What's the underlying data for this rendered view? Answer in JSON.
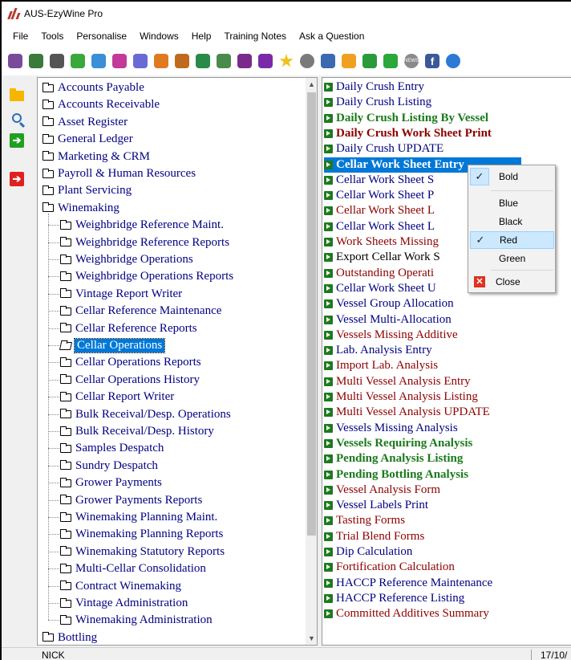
{
  "window": {
    "title": "AUS-EzyWine Pro"
  },
  "menubar": [
    "File",
    "Tools",
    "Personalise",
    "Windows",
    "Help",
    "Training Notes",
    "Ask a Question"
  ],
  "toolbar": {
    "icons": [
      {
        "name": "grapes-icon",
        "color": "#7a4a9a"
      },
      {
        "name": "pencil-icon",
        "color": "#3a7a3a"
      },
      {
        "name": "bank-icon",
        "color": "#555555"
      },
      {
        "name": "money-icon",
        "color": "#3aa83a"
      },
      {
        "name": "window-icon",
        "color": "#3a8fd6"
      },
      {
        "name": "people-icon",
        "color": "#c23a9a"
      },
      {
        "name": "wand-icon",
        "color": "#6a6ad6"
      },
      {
        "name": "barrel-icon",
        "color": "#e07a20"
      },
      {
        "name": "box-icon",
        "color": "#c06a20"
      },
      {
        "name": "bottles-icon",
        "color": "#2a8a4a"
      },
      {
        "name": "person-icon",
        "color": "#4a8a4a"
      },
      {
        "name": "glass-icon",
        "color": "#7a2a8a"
      },
      {
        "name": "grape-bunch-icon",
        "color": "#7a2aa8"
      },
      {
        "name": "star-icon",
        "color": "#f0c020"
      },
      {
        "name": "gear-icon",
        "color": "#7a7a7a"
      },
      {
        "name": "screen-icon",
        "color": "#3a6ab0"
      },
      {
        "name": "package-icon",
        "color": "#f0a020"
      },
      {
        "name": "plant-icon",
        "color": "#2a9a3a"
      },
      {
        "name": "dollar-icon",
        "color": "#2aa83a"
      },
      {
        "name": "news-icon",
        "color": "#8a8a8a"
      },
      {
        "name": "facebook-icon",
        "color": "#3b5998"
      },
      {
        "name": "globe-icon",
        "color": "#2a7ad6"
      }
    ],
    "news_label": "NEWS",
    "facebook_label": "f"
  },
  "tree": {
    "items": [
      {
        "label": "Accounts Payable",
        "level": 0
      },
      {
        "label": "Accounts Receivable",
        "level": 0
      },
      {
        "label": "Asset Register",
        "level": 0
      },
      {
        "label": "General Ledger",
        "level": 0
      },
      {
        "label": "Marketing & CRM",
        "level": 0
      },
      {
        "label": "Payroll & Human Resources",
        "level": 0
      },
      {
        "label": "Plant Servicing",
        "level": 0
      },
      {
        "label": "Winemaking",
        "level": 0
      },
      {
        "label": "Weighbridge Reference Maint.",
        "level": 1
      },
      {
        "label": "Weighbridge Reference Reports",
        "level": 1
      },
      {
        "label": "Weighbridge Operations",
        "level": 1
      },
      {
        "label": "Weighbridge Operations Reports",
        "level": 1
      },
      {
        "label": "Vintage Report Writer",
        "level": 1
      },
      {
        "label": "Cellar Reference Maintenance",
        "level": 1
      },
      {
        "label": "Cellar Reference Reports",
        "level": 1
      },
      {
        "label": "Cellar Operations",
        "level": 1,
        "selected": true
      },
      {
        "label": "Cellar Operations Reports",
        "level": 1
      },
      {
        "label": "Cellar Operations History",
        "level": 1
      },
      {
        "label": "Cellar Report Writer",
        "level": 1
      },
      {
        "label": "Bulk Receival/Desp. Operations",
        "level": 1
      },
      {
        "label": "Bulk Receival/Desp. History",
        "level": 1
      },
      {
        "label": "Samples Despatch",
        "level": 1
      },
      {
        "label": "Sundry Despatch",
        "level": 1
      },
      {
        "label": "Grower Payments",
        "level": 1
      },
      {
        "label": "Grower Payments Reports",
        "level": 1
      },
      {
        "label": "Winemaking Planning Maint.",
        "level": 1
      },
      {
        "label": "Winemaking Planning Reports",
        "level": 1
      },
      {
        "label": "Winemaking Statutory Reports",
        "level": 1
      },
      {
        "label": "Multi-Cellar Consolidation",
        "level": 1
      },
      {
        "label": "Contract Winemaking",
        "level": 1
      },
      {
        "label": "Vintage Administration",
        "level": 1
      },
      {
        "label": "Winemaking Administration",
        "level": 1
      },
      {
        "label": "Bottling",
        "level": 0
      }
    ]
  },
  "operations": {
    "items": [
      {
        "label": "Daily Crush Entry",
        "color": "#000080",
        "bold": false
      },
      {
        "label": "Daily Crush Listing",
        "color": "#000080",
        "bold": false
      },
      {
        "label": "Daily Crush Listing By Vessel",
        "color": "#1a7a1a",
        "bold": true
      },
      {
        "label": "Daily Crush Work Sheet Print",
        "color": "#8b0000",
        "bold": true
      },
      {
        "label": "Daily Crush UPDATE",
        "color": "#000080",
        "bold": false
      },
      {
        "label": "Cellar Work Sheet Entry",
        "color": "#ffffff",
        "bold": true,
        "selected": true
      },
      {
        "label": "Cellar Work Sheet S",
        "color": "#000080",
        "bold": false
      },
      {
        "label": "Cellar Work Sheet P",
        "color": "#000080",
        "bold": false
      },
      {
        "label": "Cellar Work Sheet L",
        "color": "#8b0000",
        "bold": false
      },
      {
        "label": "Cellar Work Sheet L",
        "color": "#000080",
        "bold": false
      },
      {
        "label": "Work Sheets Missing",
        "color": "#8b0000",
        "bold": false
      },
      {
        "label": "Export Cellar Work S",
        "color": "#000000",
        "bold": false
      },
      {
        "label": "Outstanding Operati",
        "color": "#8b0000",
        "bold": false
      },
      {
        "label": "Cellar Work Sheet U",
        "color": "#000080",
        "bold": false
      },
      {
        "label": "Vessel Group Allocation",
        "color": "#000080",
        "bold": false
      },
      {
        "label": "Vessel Multi-Allocation",
        "color": "#000080",
        "bold": false
      },
      {
        "label": "Vessels Missing Additive",
        "color": "#8b0000",
        "bold": false
      },
      {
        "label": "Lab. Analysis Entry",
        "color": "#000080",
        "bold": false
      },
      {
        "label": "Import Lab. Analysis",
        "color": "#8b0000",
        "bold": false
      },
      {
        "label": "Multi Vessel Analysis Entry",
        "color": "#8b0000",
        "bold": false
      },
      {
        "label": "Multi Vessel Analysis Listing",
        "color": "#8b0000",
        "bold": false
      },
      {
        "label": "Multi Vessel Analysis UPDATE",
        "color": "#8b0000",
        "bold": false
      },
      {
        "label": "Vessels Missing Analysis",
        "color": "#000080",
        "bold": false
      },
      {
        "label": "Vessels Requiring Analysis",
        "color": "#1a7a1a",
        "bold": true
      },
      {
        "label": "Pending Analysis Listing",
        "color": "#1a7a1a",
        "bold": true
      },
      {
        "label": "Pending Bottling Analysis",
        "color": "#1a7a1a",
        "bold": true
      },
      {
        "label": "Vessel Analysis Form",
        "color": "#8b0000",
        "bold": false
      },
      {
        "label": "Vessel Labels Print",
        "color": "#000080",
        "bold": false
      },
      {
        "label": "Tasting Forms",
        "color": "#8b0000",
        "bold": false
      },
      {
        "label": "Trial Blend Forms",
        "color": "#8b0000",
        "bold": false
      },
      {
        "label": "Dip Calculation",
        "color": "#000080",
        "bold": false
      },
      {
        "label": "Fortification Calculation",
        "color": "#8b0000",
        "bold": false
      },
      {
        "label": "HACCP Reference Maintenance",
        "color": "#000080",
        "bold": false
      },
      {
        "label": "HACCP Reference Listing",
        "color": "#000080",
        "bold": false
      },
      {
        "label": "Committed Additives Summary",
        "color": "#8b0000",
        "bold": false
      }
    ]
  },
  "context_menu": {
    "bold_label": "Bold",
    "blue_label": "Blue",
    "black_label": "Black",
    "red_label": "Red",
    "green_label": "Green",
    "close_label": "Close",
    "checkmark": "✓",
    "close_glyph": "✕"
  },
  "sidebar": {
    "arrow_glyph": "➔"
  },
  "statusbar": {
    "user": "NICK",
    "date": "17/10/"
  }
}
